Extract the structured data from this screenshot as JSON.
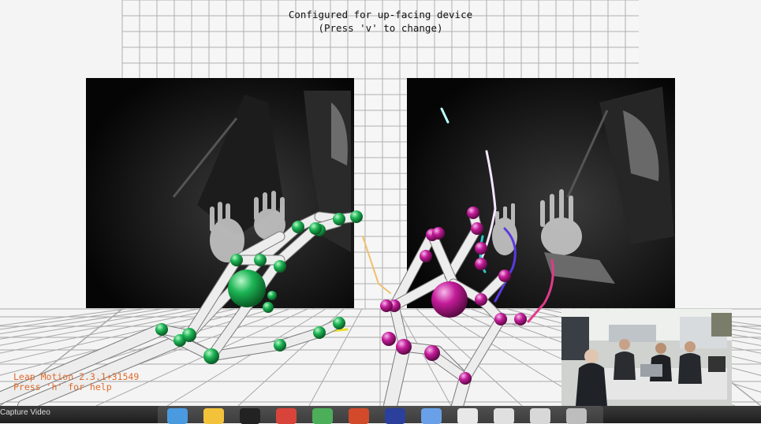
{
  "hud": {
    "config_line": "Configured for up-facing device",
    "change_hint": "(Press 'v' to change)",
    "version": "Leap Motion 2.3.1+31549",
    "help_hint": "Press 'h' for help"
  },
  "colors": {
    "left_hand_joint": "#18b050",
    "right_hand_joint": "#c81c9c",
    "bone": "#ececec",
    "grid_line": "#a9a9a9",
    "hud_text": "#111111",
    "status_text": "#e06a2a"
  },
  "taskbar": {
    "caption": "Capture Video",
    "dock_icons": [
      {
        "name": "finder-icon",
        "color": "#4a9ae0"
      },
      {
        "name": "notes-icon",
        "color": "#f2c23a"
      },
      {
        "name": "terminal-icon",
        "color": "#222222"
      },
      {
        "name": "chrome-icon",
        "color": "#d9443a"
      },
      {
        "name": "android-studio-icon",
        "color": "#4cae58"
      },
      {
        "name": "powerpoint-icon",
        "color": "#d24a2a"
      },
      {
        "name": "calendar-icon",
        "color": "#2b3f9c"
      },
      {
        "name": "folder-icon",
        "color": "#6aa0e8"
      },
      {
        "name": "window-preview-1-icon",
        "color": "#e8e8e8"
      },
      {
        "name": "window-preview-2-icon",
        "color": "#e0e0e0"
      },
      {
        "name": "window-preview-3-icon",
        "color": "#d8d8d8"
      },
      {
        "name": "trash-icon",
        "color": "#bdbdbd"
      }
    ]
  }
}
